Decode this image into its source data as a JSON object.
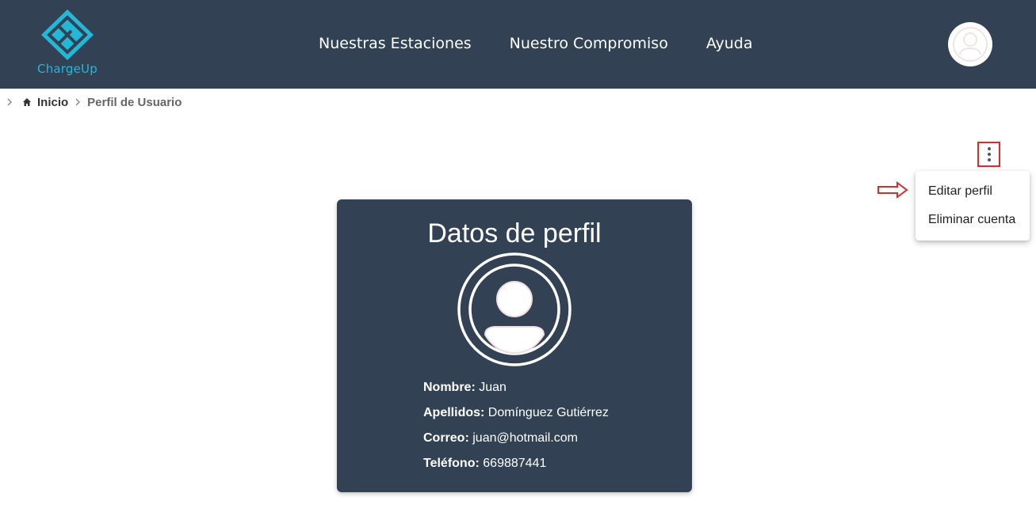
{
  "app": {
    "brand": "ChargeUp",
    "colors": {
      "navbar": "#334155",
      "brand_accent": "#22b8d6",
      "highlight_box": "#d32f2f"
    }
  },
  "nav": {
    "links": [
      "Nuestras Estaciones",
      "Nuestro Compromiso",
      "Ayuda"
    ],
    "avatar_icon": "user-avatar-icon"
  },
  "breadcrumb": {
    "home": "Inicio",
    "current": "Perfil de Usuario"
  },
  "menu": {
    "items": [
      "Editar perfil",
      "Eliminar cuenta"
    ]
  },
  "profile": {
    "title": "Datos de perfil",
    "fields": [
      {
        "label": "Nombre:",
        "value": "Juan"
      },
      {
        "label": "Apellidos:",
        "value": "Domínguez Gutiérrez"
      },
      {
        "label": "Correo:",
        "value": "juan@hotmail.com"
      },
      {
        "label": "Teléfono:",
        "value": "669887441"
      }
    ]
  }
}
